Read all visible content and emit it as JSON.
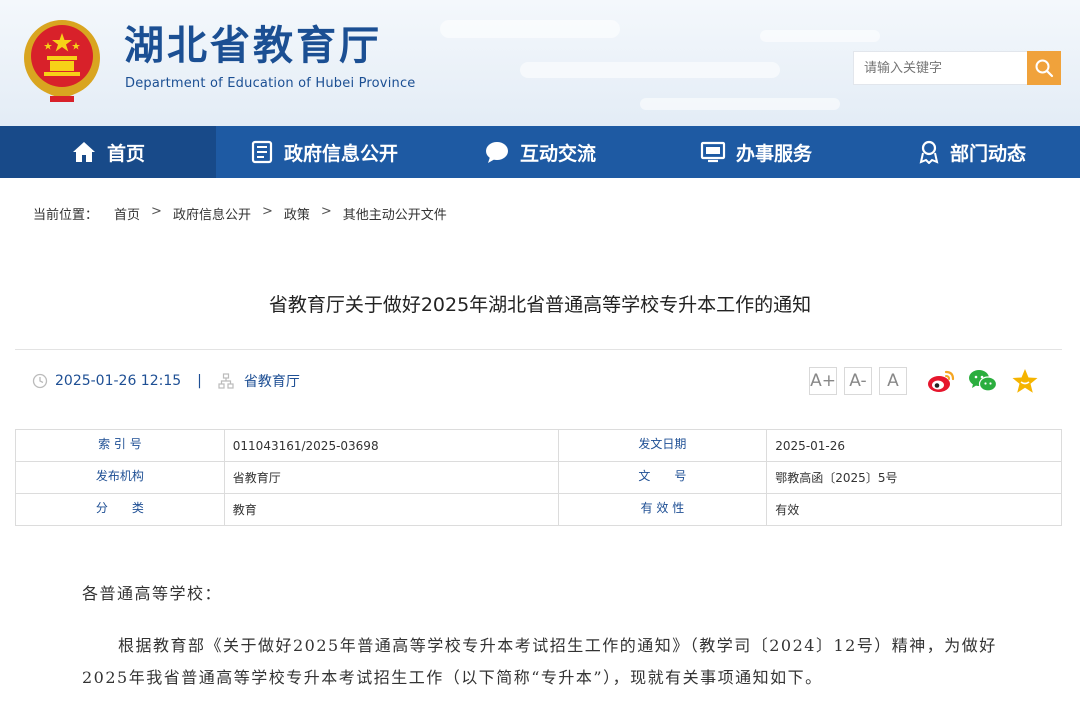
{
  "header": {
    "title": "湖北省教育厅",
    "subtitle": "Department of Education of Hubei Province",
    "search_placeholder": "请输入关键字"
  },
  "nav": [
    {
      "label": "首页",
      "icon": "home-icon",
      "active": true
    },
    {
      "label": "政府信息公开",
      "icon": "document-icon"
    },
    {
      "label": "互动交流",
      "icon": "chat-icon"
    },
    {
      "label": "办事服务",
      "icon": "monitor-icon"
    },
    {
      "label": "部门动态",
      "icon": "person-badge-icon"
    }
  ],
  "breadcrumb": {
    "prefix": "当前位置：",
    "items": [
      "首页",
      "政府信息公开",
      "政策",
      "其他主动公开文件"
    ],
    "separator": ">"
  },
  "article": {
    "title": "省教育厅关于做好2025年湖北省普通高等学校专升本工作的通知",
    "datetime": "2025-01-26 12:15",
    "meta_separator": "|",
    "source": "省教育厅"
  },
  "font_buttons": [
    "A+",
    "A-",
    "A"
  ],
  "share_icons": [
    "weibo-icon",
    "wechat-icon",
    "favorite-star-icon"
  ],
  "info_table": {
    "rows": [
      {
        "l1": "索 引 号",
        "v1": "011043161/2025-03698",
        "l2": "发文日期",
        "v2": "2025-01-26"
      },
      {
        "l1": "发布机构",
        "v1": "省教育厅",
        "l2": "文　　号",
        "v2": "鄂教高函〔2025〕5号"
      },
      {
        "l1": "分　　类",
        "v1": "教育",
        "l2": "有 效 性",
        "v2": "有效"
      }
    ]
  },
  "body": {
    "salutation": "各普通高等学校：",
    "paragraph1": "根据教育部《关于做好2025年普通高等学校专升本考试招生工作的通知》（教学司〔2024〕12号）精神，为做好2025年我省普通高等学校专升本考试招生工作（以下简称“专升本”），现就有关事项通知如下。"
  },
  "colors": {
    "nav_bg": "#1e5aa3",
    "nav_active": "#184a89",
    "title_blue": "#1b4f93",
    "search_btn": "#f0a23b",
    "weibo": "#e6162d",
    "wechat": "#2bae3e",
    "star": "#f5b400"
  }
}
